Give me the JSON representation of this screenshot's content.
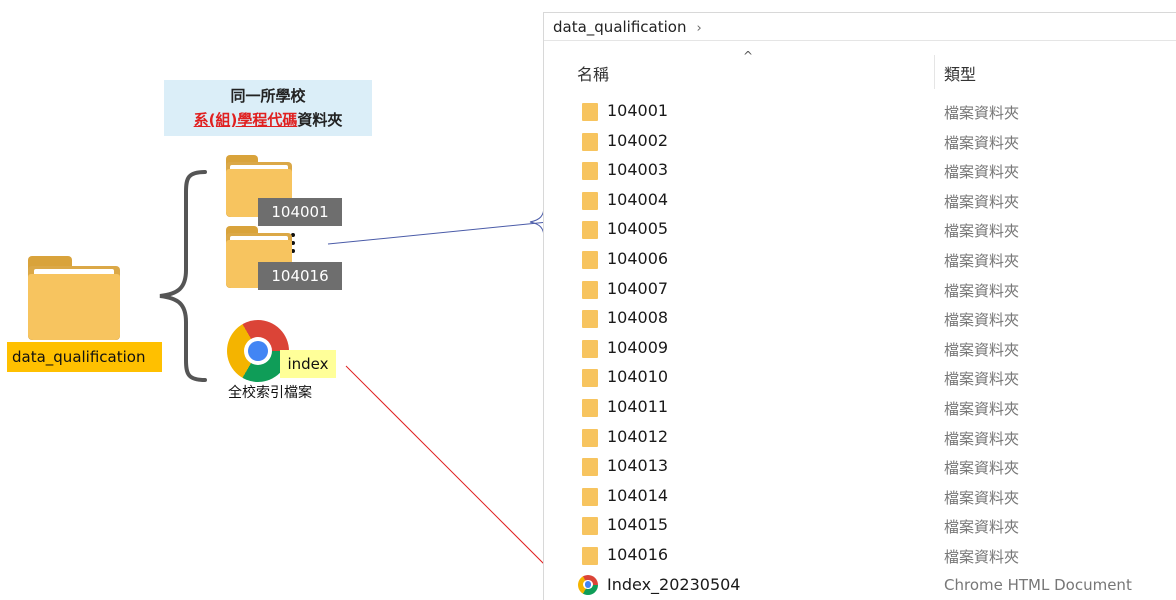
{
  "note": {
    "line1": "同一所學校",
    "line2_highlight": "系(組)學程代碼",
    "line2_suffix": "資料夾"
  },
  "root_folder_label": "data_qualification",
  "subfolder_first": "104001",
  "subfolder_last": "104016",
  "index": {
    "label": "index",
    "caption": "全校索引檔案"
  },
  "explorer": {
    "breadcrumb": "data_qualification",
    "breadcrumb_sep": "›",
    "sort_caret": "^",
    "columns": {
      "name": "名稱",
      "type": "類型"
    },
    "folder_type": "檔案資料夾",
    "folders": [
      "104001",
      "104002",
      "104003",
      "104004",
      "104005",
      "104006",
      "104007",
      "104008",
      "104009",
      "104010",
      "104011",
      "104012",
      "104013",
      "104014",
      "104015",
      "104016"
    ],
    "file": {
      "name": "Index_20230504",
      "type": "Chrome HTML Document"
    }
  },
  "colors": {
    "folder": "#f7c45f",
    "root_label_bg": "#ffc000",
    "note_bg": "#dbeef8",
    "highlight_red": "#e02020",
    "connector_blue": "#4a5ba8",
    "connector_red": "#e02020"
  }
}
